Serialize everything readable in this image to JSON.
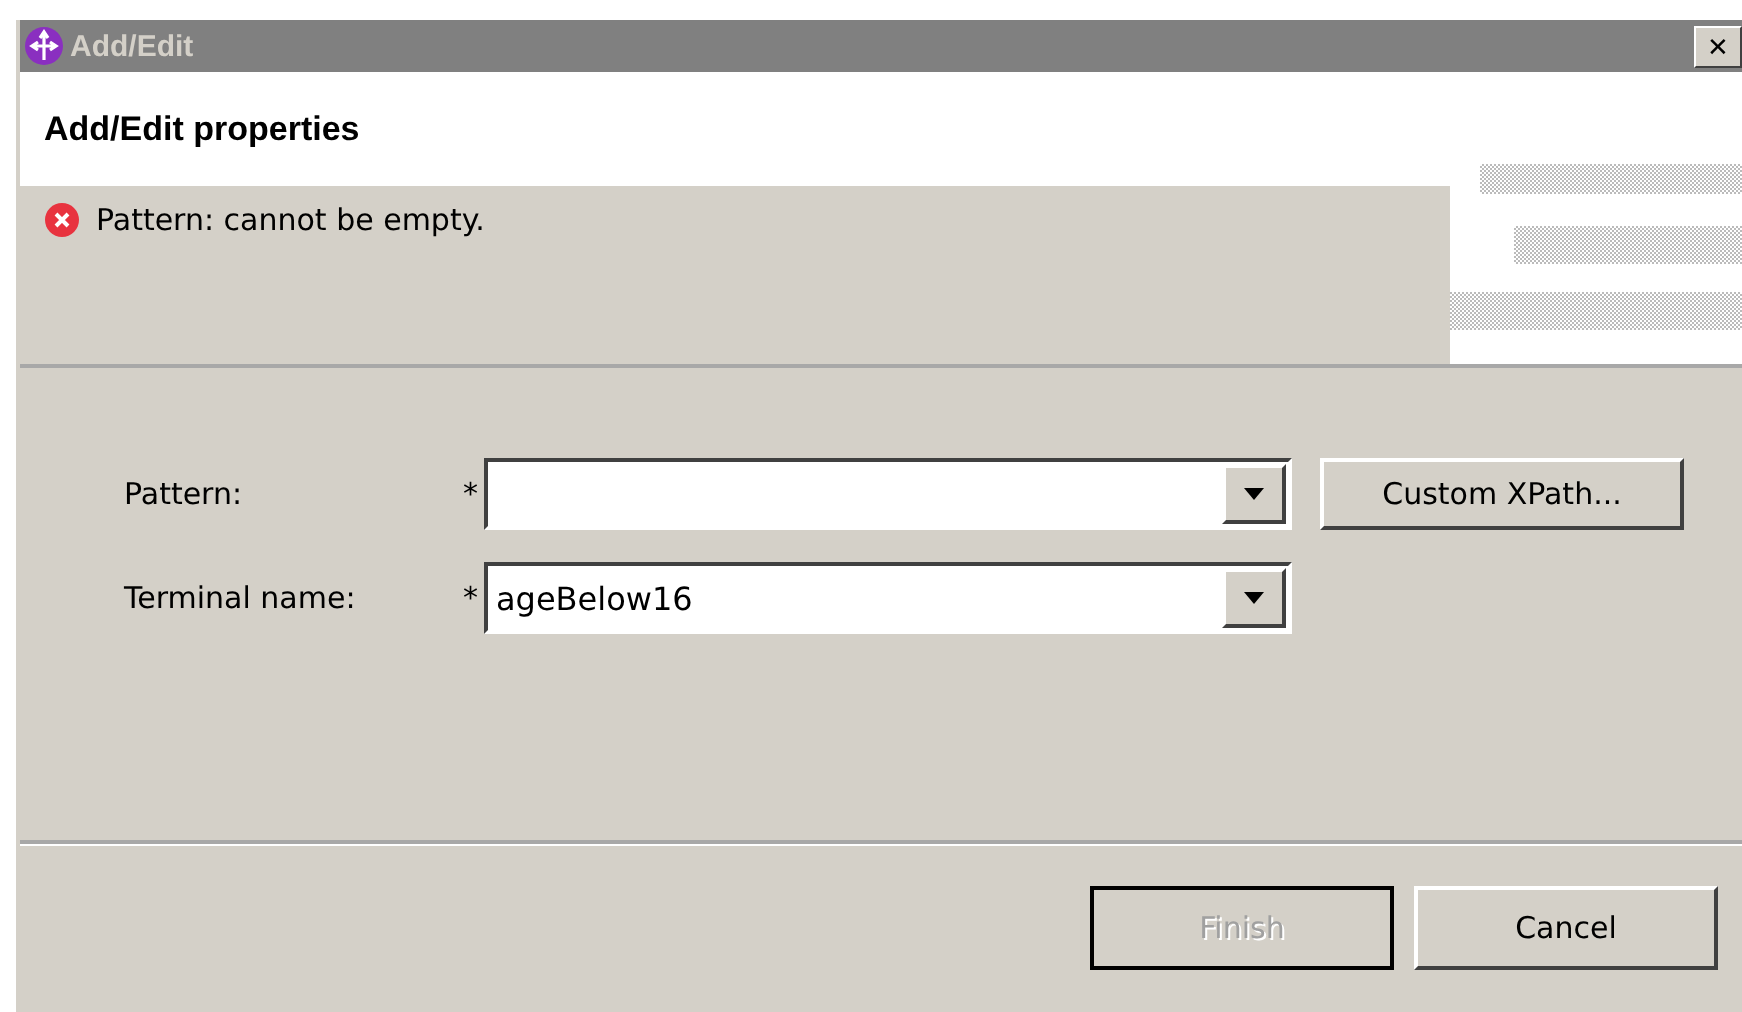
{
  "window": {
    "title": "Add/Edit",
    "close": "✕"
  },
  "header": {
    "title": "Add/Edit properties",
    "message": {
      "kind": "error",
      "text": "Pattern: cannot be empty."
    }
  },
  "fields": [
    {
      "label": "Pattern:",
      "required": "*",
      "button": "Custom XPath..."
    },
    {
      "label": "Terminal name:",
      "required": "*",
      "value": "ageBelow16"
    }
  ],
  "buttons": [
    {
      "label": "Finish",
      "disabled": true,
      "default": true
    },
    {
      "label": "Cancel",
      "disabled": false,
      "default": false
    }
  ]
}
